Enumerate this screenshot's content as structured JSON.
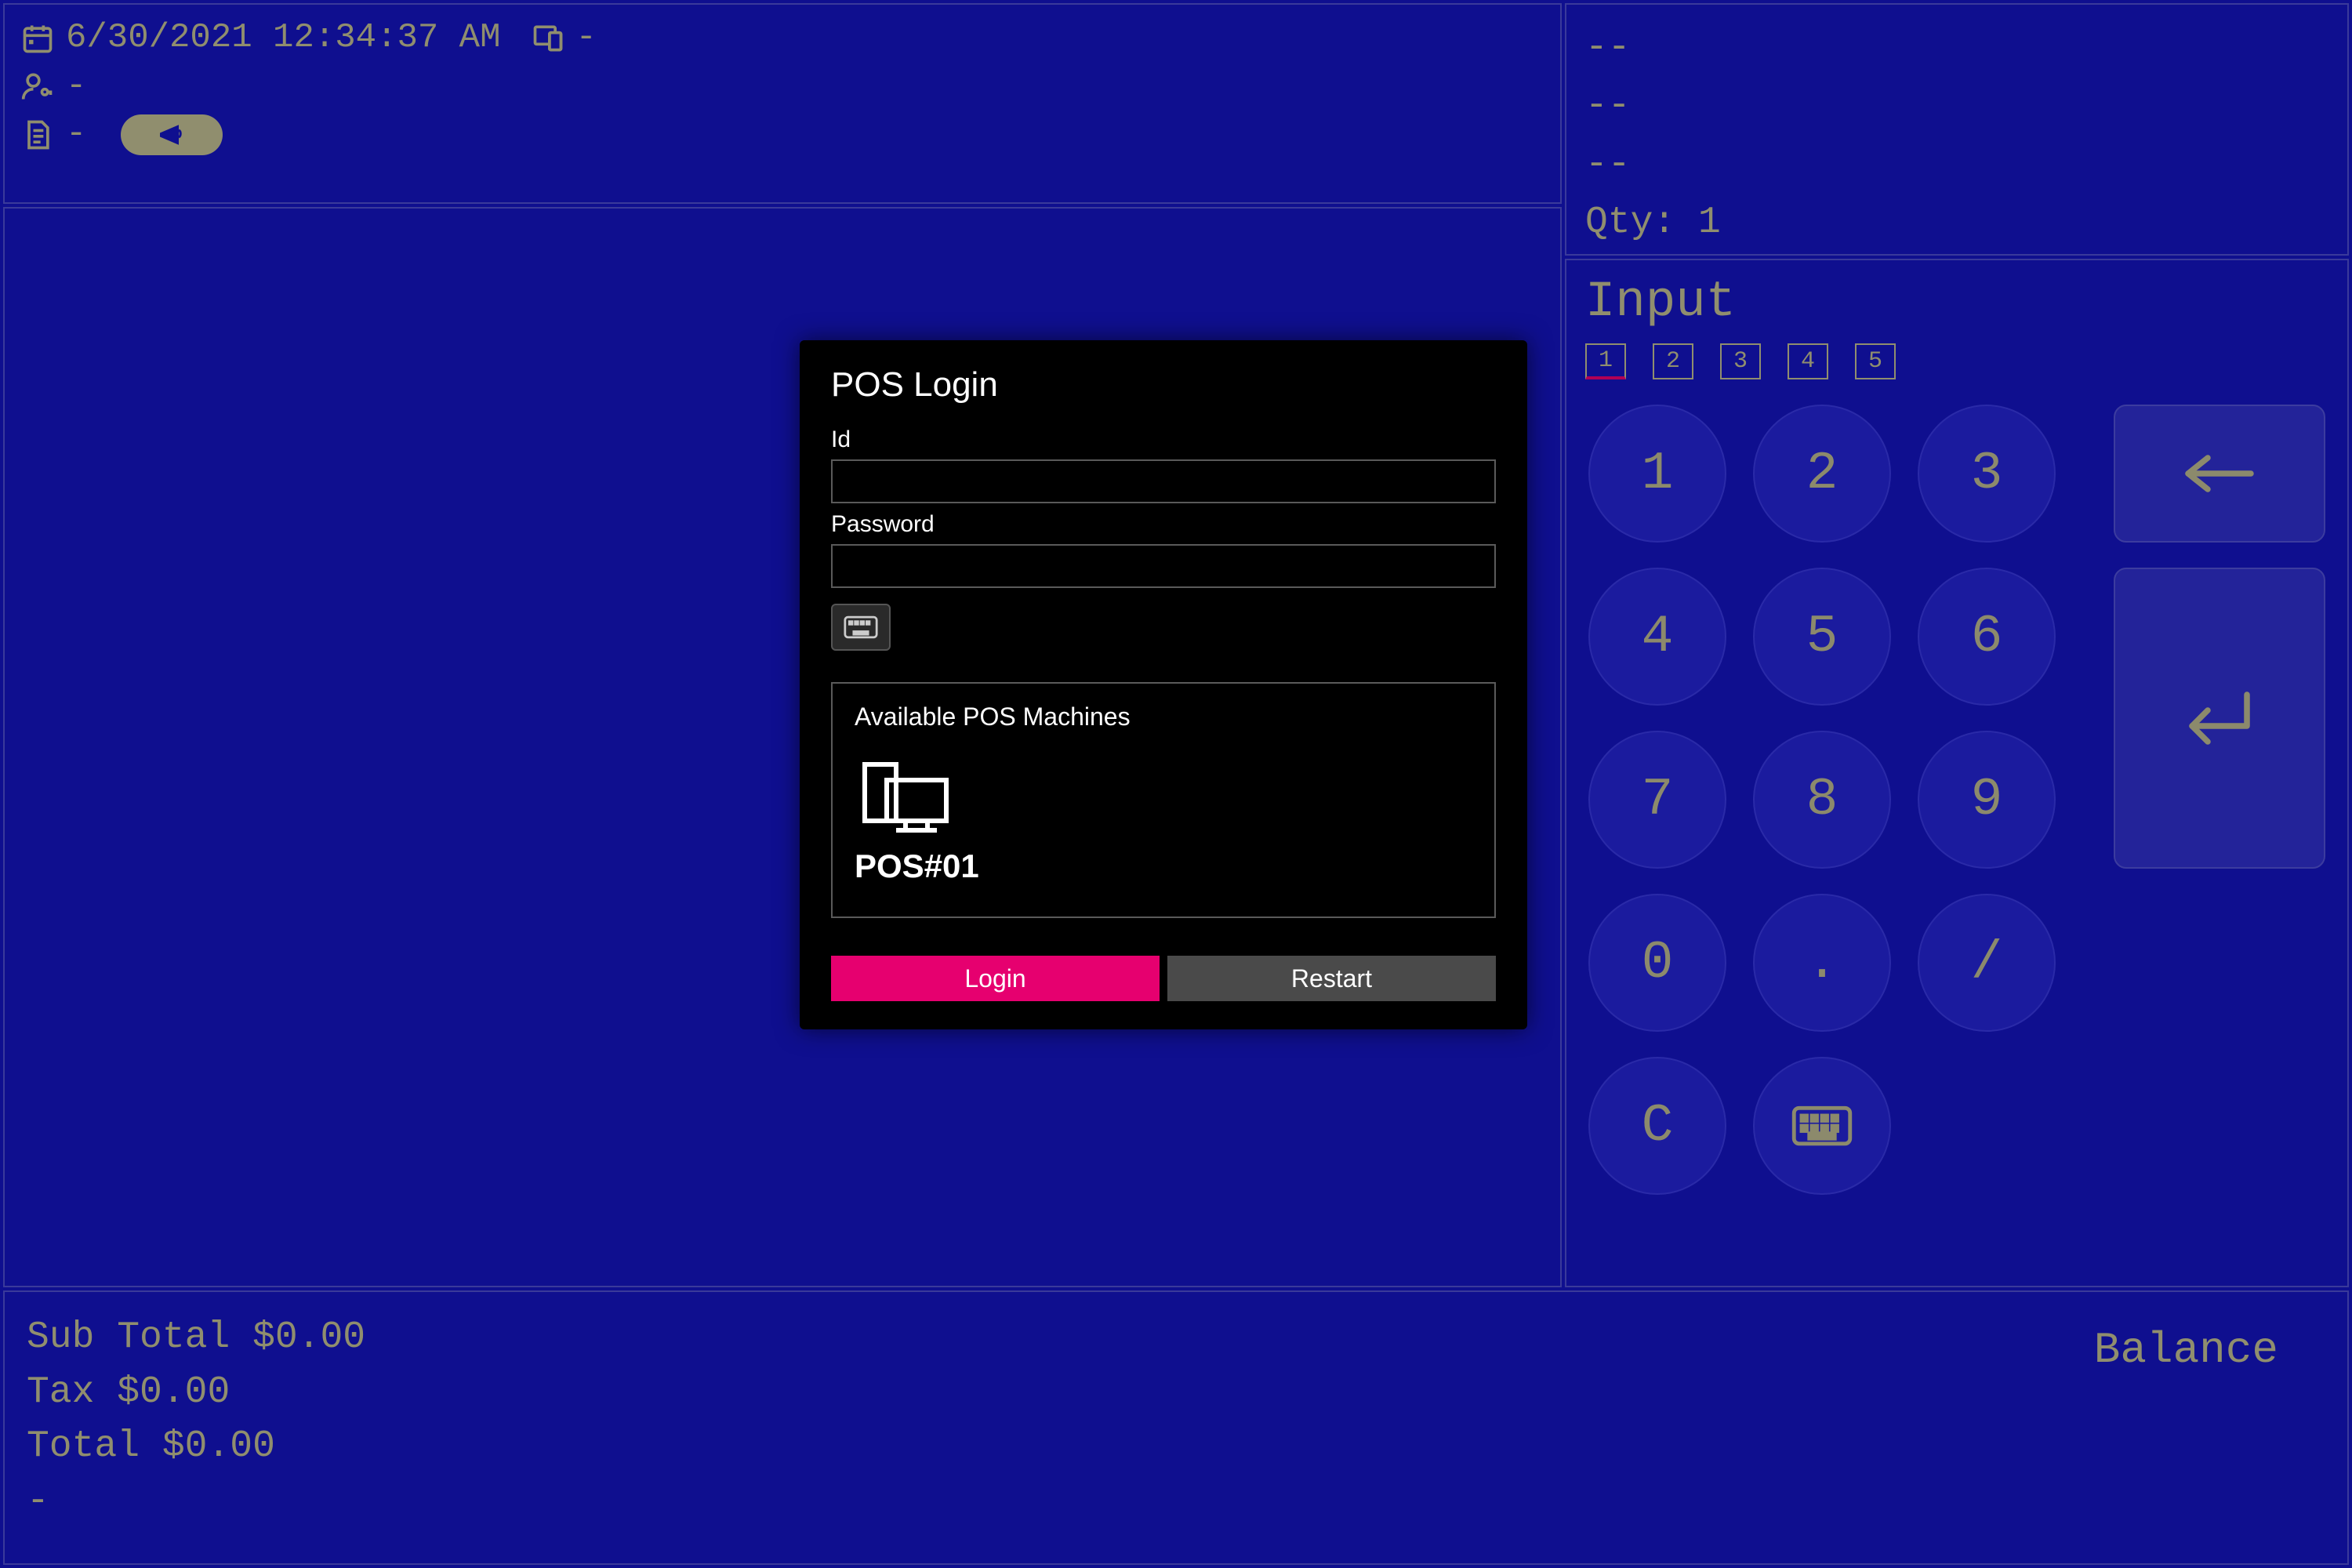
{
  "status": {
    "datetime": "6/30/2021 12:34:37 AM",
    "terminal": "-",
    "user": "-",
    "doc": "-"
  },
  "right_info": {
    "line1": "--",
    "line2": "--",
    "line3": "--",
    "qty_label": "Qty:",
    "qty_value": "1"
  },
  "input_panel": {
    "label": "Input",
    "tabs": [
      "1",
      "2",
      "3",
      "4",
      "5"
    ],
    "active_tab_index": 0,
    "keys": {
      "k1": "1",
      "k2": "2",
      "k3": "3",
      "k4": "4",
      "k5": "5",
      "k6": "6",
      "k7": "7",
      "k8": "8",
      "k9": "9",
      "k0": "0",
      "kdot": ".",
      "kslash": "/",
      "kc": "C"
    }
  },
  "totals": {
    "sub_label": "Sub Total",
    "sub_value": "$0.00",
    "tax_label": "Tax",
    "tax_value": "$0.00",
    "total_label": "Total",
    "total_value": "$0.00",
    "extra_line": "-",
    "balance_label": "Balance"
  },
  "login": {
    "title": "POS Login",
    "id_label": "Id",
    "id_value": "",
    "password_label": "Password",
    "password_value": "",
    "available_title": "Available POS Machines",
    "machine_label": "POS#01",
    "login_button": "Login",
    "restart_button": "Restart"
  }
}
